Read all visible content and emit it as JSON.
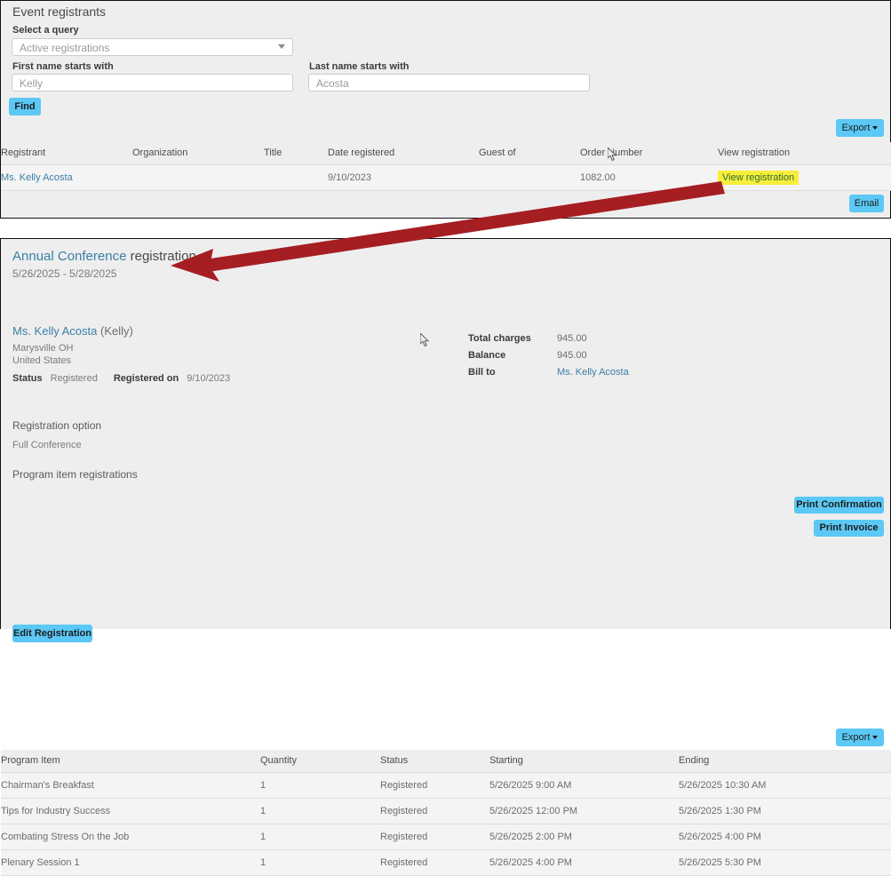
{
  "top_panel": {
    "title": "Event registrants",
    "query": {
      "label": "Select a query",
      "value": "Active registrations",
      "options": [
        "Active registrations"
      ]
    },
    "first_name": {
      "label": "First name starts with",
      "value": "Kelly",
      "placeholder": "Kelly"
    },
    "last_name": {
      "label": "Last name starts with",
      "value": "Acosta",
      "placeholder": "Acosta"
    },
    "find_button": "Find",
    "export_button": "Export",
    "email_button": "Email",
    "table": {
      "headers": [
        "Registrant",
        "Organization",
        "Title",
        "Date registered",
        "Guest of",
        "Order Number",
        "View registration"
      ],
      "rows": [
        {
          "registrant": "Ms. Kelly Acosta",
          "organization": "",
          "title": "",
          "date_registered": "9/10/2023",
          "guest_of": "",
          "order_number": "1082.00",
          "view_registration": "View registration"
        }
      ]
    }
  },
  "bottom_panel": {
    "event_name": "Annual Conference",
    "title_suffix": " registration",
    "dates": "5/26/2025 - 5/28/2025",
    "print_confirmation_button": "Print Confirmation",
    "print_invoice_button": "Print Invoice",
    "attendee": {
      "name": "Ms. Kelly Acosta",
      "nickname": "(Kelly)",
      "city_state": "Marysville OH",
      "country": "United States",
      "status_label": "Status",
      "status_value": "Registered",
      "registered_on_label": "Registered on",
      "registered_on_value": "9/10/2023",
      "edit_button": "Edit Registration"
    },
    "charges": {
      "total_charges_label": "Total charges",
      "total_charges_value": "945.00",
      "balance_label": "Balance",
      "balance_value": "945.00",
      "bill_to_label": "Bill to",
      "bill_to_value": "Ms. Kelly Acosta"
    },
    "registration_option_heading": "Registration option",
    "registration_option_value": "Full Conference",
    "program_items_heading": "Program item registrations",
    "export_button": "Export",
    "program_table": {
      "headers": [
        "Program Item",
        "Quantity",
        "Status",
        "Starting",
        "Ending"
      ],
      "rows": [
        {
          "item": "Chairman's Breakfast",
          "quantity": "1",
          "status": "Registered",
          "starting": "5/26/2025 9:00 AM",
          "ending": "5/26/2025 10:30 AM"
        },
        {
          "item": "Tips for Industry Success",
          "quantity": "1",
          "status": "Registered",
          "starting": "5/26/2025 12:00 PM",
          "ending": "5/26/2025 1:30 PM"
        },
        {
          "item": "Combating Stress On the Job",
          "quantity": "1",
          "status": "Registered",
          "starting": "5/26/2025 2:00 PM",
          "ending": "5/26/2025 4:00 PM"
        },
        {
          "item": "Plenary Session 1",
          "quantity": "1",
          "status": "Registered",
          "starting": "5/26/2025 4:00 PM",
          "ending": "5/26/2025 5:30 PM"
        }
      ]
    }
  },
  "annotation": {
    "arrow_color": "#a51e22",
    "description": "red arrow pointing from View registration button to Annual Conference registration"
  },
  "colors": {
    "button_blue": "#5bc8f5",
    "link_blue": "#3a7fa5",
    "highlight_yellow": "#f7ee3c",
    "highlight_text_green": "#2e6b2e",
    "panel_background": "#eeeeee"
  }
}
